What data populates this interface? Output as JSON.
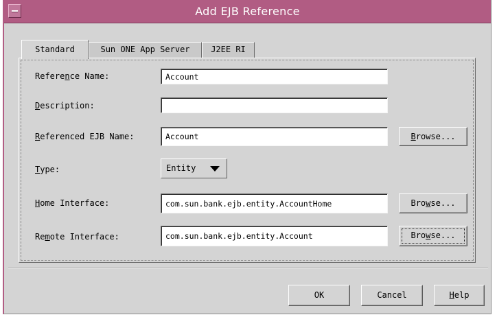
{
  "window": {
    "title": "Add EJB Reference",
    "accent_color": "#b15c83"
  },
  "tabs": [
    {
      "label": "Standard",
      "active": true
    },
    {
      "label": "Sun ONE App Server",
      "active": false
    },
    {
      "label": "J2EE RI",
      "active": false
    }
  ],
  "form": {
    "reference_name": {
      "pre": "Refere",
      "mn": "n",
      "post": "ce Name:",
      "value": "Account"
    },
    "description": {
      "pre": "",
      "mn": "D",
      "post": "escription:",
      "value": ""
    },
    "referenced_ejb_name": {
      "pre": "",
      "mn": "R",
      "post": "eferenced EJB Name:",
      "value": "Account"
    },
    "type": {
      "pre": "",
      "mn": "T",
      "post": "ype:",
      "value": "Entity",
      "icon": "chevron-down-icon"
    },
    "home_interface": {
      "pre": "",
      "mn": "H",
      "post": "ome Interface:",
      "value": "com.sun.bank.ejb.entity.AccountHome"
    },
    "remote_interface": {
      "pre": "Re",
      "mn": "m",
      "post": "ote Interface:",
      "value": "com.sun.bank.ejb.entity.Account"
    }
  },
  "browse": {
    "ejb": {
      "pre": "",
      "mn": "B",
      "post": "rowse..."
    },
    "home": {
      "pre": "Bro",
      "mn": "w",
      "post": "se..."
    },
    "remote": {
      "pre": "Bro",
      "mn": "w",
      "post": "se..."
    }
  },
  "buttons": {
    "ok": "OK",
    "cancel": "Cancel",
    "help": {
      "mn": "H",
      "post": "elp"
    }
  }
}
